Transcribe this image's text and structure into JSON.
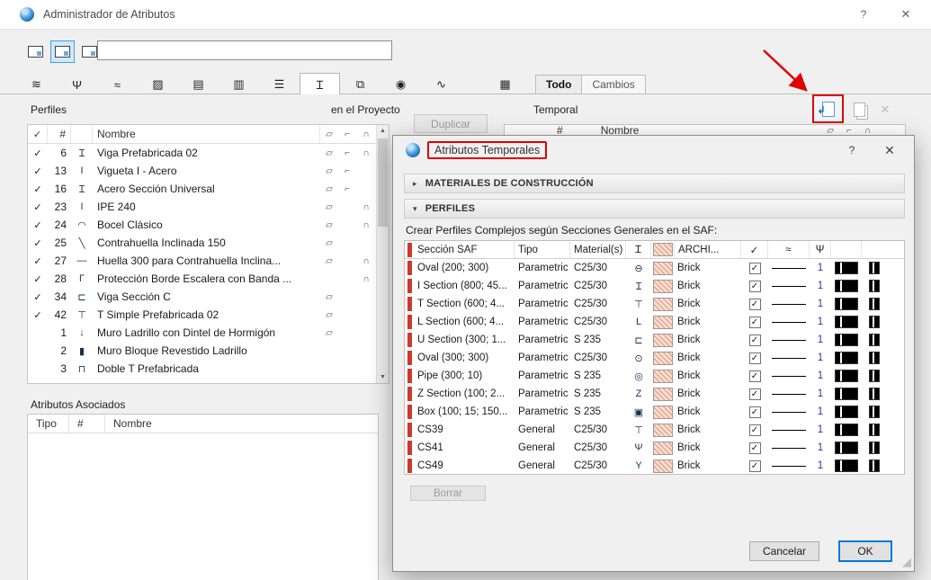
{
  "colors": {
    "annotation": "#e00000",
    "accent": "#0078d7",
    "red_bar": "#cc3a2e"
  },
  "titlebar": {
    "title": "Administrador de Atributos",
    "help": "?",
    "close": "✕"
  },
  "toolbar": {
    "search_value": ""
  },
  "tabs": {
    "items": [
      {
        "name": "layers",
        "glyph": "≋"
      },
      {
        "name": "pens",
        "glyph": "Ψ"
      },
      {
        "name": "line-types",
        "glyph": "≈"
      },
      {
        "name": "fill-types",
        "glyph": "▨"
      },
      {
        "name": "composites",
        "glyph": "▤"
      },
      {
        "name": "building-materials",
        "glyph": "▥"
      },
      {
        "name": "surfaces",
        "glyph": "☰"
      },
      {
        "name": "profiles",
        "glyph": "Ɪ",
        "selected": true
      },
      {
        "name": "zone-categories",
        "glyph": "⧉"
      },
      {
        "name": "locations",
        "glyph": "◉"
      },
      {
        "name": "markup-styles",
        "glyph": "∿"
      }
    ],
    "grid_tab_glyph": "▦",
    "todo": "Todo",
    "cambios": "Cambios"
  },
  "headers": {
    "left_panel": "Perfiles",
    "scope": "en el Proyecto",
    "right_panel": "Temporal",
    "duplicar": "Duplicar"
  },
  "icons": {
    "scroll_up": "▲",
    "scroll_down": "▼",
    "delete": "✕",
    "import_arrow": "↲",
    "grip": "◢"
  },
  "left_list": {
    "check_header": "✓",
    "num_header": "#",
    "name_header": "Nombre",
    "badge_headers": [
      "▱",
      "⌐",
      "∩"
    ],
    "rows": [
      {
        "check": "✓",
        "num": "6",
        "glyph": "Ɪ",
        "name": "Viga Prefabricada 02",
        "b1": "▱",
        "b2": "⌐",
        "b3": "∩"
      },
      {
        "check": "✓",
        "num": "13",
        "glyph": "I",
        "name": "Vigueta I - Acero",
        "b1": "▱",
        "b2": "⌐",
        "b3": ""
      },
      {
        "check": "✓",
        "num": "16",
        "glyph": "Ɪ",
        "name": "Acero Sección Universal",
        "b1": "▱",
        "b2": "⌐",
        "b3": ""
      },
      {
        "check": "✓",
        "num": "23",
        "glyph": "I",
        "name": "IPE 240",
        "b1": "▱",
        "b2": "",
        "b3": "∩"
      },
      {
        "check": "✓",
        "num": "24",
        "glyph": "◠",
        "name": "Bocel Clásico",
        "b1": "▱",
        "b2": "",
        "b3": "∩"
      },
      {
        "check": "✓",
        "num": "25",
        "glyph": "╲",
        "name": "Contrahuella Inclinada 150",
        "b1": "▱",
        "b2": "",
        "b3": ""
      },
      {
        "check": "✓",
        "num": "27",
        "glyph": "—",
        "name": "Huella 300 para Contrahuella Inclina...",
        "b1": "▱",
        "b2": "",
        "b3": "∩"
      },
      {
        "check": "✓",
        "num": "28",
        "glyph": "Γ",
        "name": "Protección Borde Escalera con Banda ...",
        "b1": "",
        "b2": "",
        "b3": "∩"
      },
      {
        "check": "✓",
        "num": "34",
        "glyph": "⊏",
        "name": "Viga Sección C",
        "b1": "▱",
        "b2": "",
        "b3": ""
      },
      {
        "check": "✓",
        "num": "42",
        "glyph": "⊤",
        "name": "T Simple Prefabricada 02",
        "b1": "▱",
        "b2": "",
        "b3": ""
      },
      {
        "check": "",
        "num": "1",
        "glyph": "↓",
        "name": "Muro Ladrillo con Dintel de Hormigón",
        "b1": "▱",
        "b2": "",
        "b3": ""
      },
      {
        "check": "",
        "num": "2",
        "glyph": "▮",
        "name": "Muro Bloque Revestido Ladrillo",
        "b1": "",
        "b2": "",
        "b3": ""
      },
      {
        "check": "",
        "num": "3",
        "glyph": "⊓",
        "name": "Doble T Prefabricada",
        "b1": "",
        "b2": "",
        "b3": ""
      }
    ]
  },
  "right_list": {
    "num_header": "#",
    "name_header": "Nombre",
    "badge_headers": [
      "▱",
      "⌐",
      "∩"
    ]
  },
  "associated": {
    "title": "Atributos Asociados",
    "col_tipo": "Tipo",
    "col_num": "#",
    "col_nombre": "Nombre"
  },
  "dialog": {
    "title": "Atributos Temporales",
    "help": "?",
    "close": "✕",
    "sections": [
      {
        "arrow": "▸",
        "label": "MATERIALES DE CONSTRUCCIÓN"
      },
      {
        "arrow": "▾",
        "label": "PERFILES"
      }
    ],
    "description": "Crear Perfiles Complejos según Secciones Generales en el SAF:",
    "table": {
      "name_header": "Sección SAF",
      "tipo_header": "Tipo",
      "material_header": "Material(s)",
      "shape_header": "Ɪ",
      "surface_header": "ARCHI...",
      "check_header": "✓",
      "line_header": "≈",
      "pen_header": "Ψ",
      "rows": [
        {
          "name": "Oval (200; 300)",
          "tipo": "Parametric",
          "material": "C25/30",
          "glyph": "⊖",
          "surface": "Brick",
          "check": "✓",
          "pen": "1"
        },
        {
          "name": "I Section (800; 45...",
          "tipo": "Parametric",
          "material": "C25/30",
          "glyph": "Ɪ",
          "surface": "Brick",
          "check": "✓",
          "pen": "1"
        },
        {
          "name": "T Section (600; 4...",
          "tipo": "Parametric",
          "material": "C25/30",
          "glyph": "⊤",
          "surface": "Brick",
          "check": "✓",
          "pen": "1"
        },
        {
          "name": "L Section (600; 4...",
          "tipo": "Parametric",
          "material": "C25/30",
          "glyph": "L",
          "surface": "Brick",
          "check": "✓",
          "pen": "1"
        },
        {
          "name": "U Section (300; 1...",
          "tipo": "Parametric",
          "material": "S 235",
          "glyph": "⊏",
          "surface": "Brick",
          "check": "✓",
          "pen": "1"
        },
        {
          "name": "Oval (300; 300)",
          "tipo": "Parametric",
          "material": "C25/30",
          "glyph": "⊙",
          "surface": "Brick",
          "check": "✓",
          "pen": "1"
        },
        {
          "name": "Pipe (300; 10)",
          "tipo": "Parametric",
          "material": "S 235",
          "glyph": "◎",
          "surface": "Brick",
          "check": "✓",
          "pen": "1"
        },
        {
          "name": "Z Section (100; 2...",
          "tipo": "Parametric",
          "material": "S 235",
          "glyph": "Z",
          "surface": "Brick",
          "check": "✓",
          "pen": "1"
        },
        {
          "name": "Box (100; 15; 150...",
          "tipo": "Parametric",
          "material": "S 235",
          "glyph": "▣",
          "surface": "Brick",
          "check": "✓",
          "pen": "1"
        },
        {
          "name": "CS39",
          "tipo": "General",
          "material": "C25/30",
          "glyph": "⊤",
          "surface": "Brick",
          "check": "✓",
          "pen": "1"
        },
        {
          "name": "CS41",
          "tipo": "General",
          "material": "C25/30",
          "glyph": "Ψ",
          "surface": "Brick",
          "check": "✓",
          "pen": "1"
        },
        {
          "name": "CS49",
          "tipo": "General",
          "material": "C25/30",
          "glyph": "Y",
          "surface": "Brick",
          "check": "✓",
          "pen": "1"
        }
      ]
    },
    "borrar": "Borrar",
    "cancel": "Cancelar",
    "ok": "OK"
  }
}
